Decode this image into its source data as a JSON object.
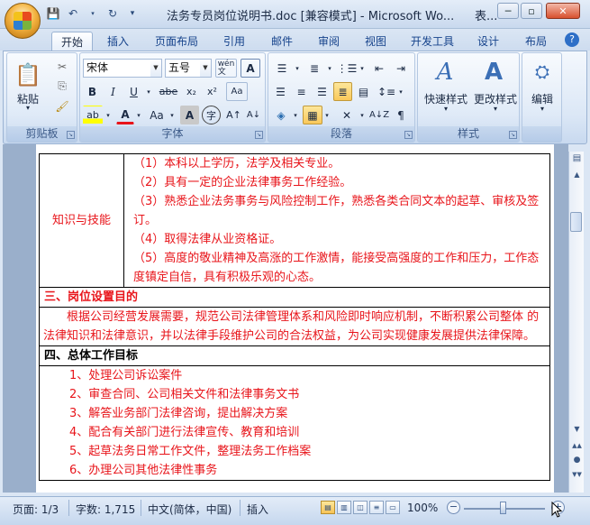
{
  "window": {
    "title": "法务专员岗位说明书.doc [兼容模式] - Microsoft Wo...",
    "extra_title": "表...",
    "controls": {
      "minimize": "─",
      "restore": "▫",
      "close": "✕"
    }
  },
  "qat": {
    "save_icon": "save-icon",
    "undo_icon": "undo-icon",
    "redo_icon": "redo-icon",
    "customize_icon": "chevron-down-icon"
  },
  "tabs": [
    "开始",
    "插入",
    "页面布局",
    "引用",
    "邮件",
    "审阅",
    "视图",
    "开发工具",
    "设计",
    "布局"
  ],
  "active_tab": "开始",
  "ribbon": {
    "clipboard": {
      "label": "剪贴板",
      "paste": "粘贴",
      "paste_arrow": "▾"
    },
    "font": {
      "label": "字体",
      "font_name": "宋体",
      "font_size": "五号",
      "wen": "wén\n文",
      "bold": "B",
      "italic": "I",
      "underline": "U",
      "strike": "abe",
      "sub": "x₂",
      "sup": "x²",
      "clear": "Aa",
      "highlight": "ab",
      "color": "A",
      "case": "Aa",
      "shade": "A",
      "circle": "字",
      "grow": "A↑",
      "shrink": "A↓"
    },
    "paragraph": {
      "label": "段落"
    },
    "styles": {
      "label": "样式",
      "quick": "快速样式",
      "change": "更改样式"
    },
    "editing": {
      "label": "",
      "edit": "编辑"
    }
  },
  "document": {
    "knowledge_label": "知识与技能",
    "requirements": [
      "（1）本科以上学历，法学及相关专业。",
      "（2）具有一定的企业法律事务工作经验。",
      "（3）熟悉企业法务事务与风险控制工作，熟悉各类合同文本的起草、审核及签订。",
      "（4）取得法律从业资格证。",
      "（5）高度的敬业精神及高涨的工作激情，能接受高强度的工作和压力，工作态度镇定自信，具有积极乐观的心态。"
    ],
    "section3_title": "三、岗位设置目的",
    "section3_text": "根据公司经营发展需要，规范公司法律管理体系和风险即时响应机制，不断积累公司整体 的法律知识和法律意识，并以法律手段维护公司的合法权益，为公司实现健康发展提供法律保障。",
    "section4_title": "四、总体工作目标",
    "goals": [
      "1、处理公司诉讼案件",
      "2、审查合同、公司相关文件和法律事务文书",
      "3、解答业务部门法律咨询，提出解决方案",
      "4、配合有关部门进行法律宣传、教育和培训",
      "5、起草法务日常工作文件，整理法务工作档案",
      "6、办理公司其他法律性事务"
    ]
  },
  "statusbar": {
    "page": "页面: 1/3",
    "words": "字数: 1,715",
    "language": "中文(简体，中国)",
    "mode": "插入",
    "zoom": "100%",
    "zoom_level": 1.0
  },
  "colors": {
    "accent": "#15428b",
    "doc_text": "#e8141a",
    "ribbon_bg": "#dbe7f6"
  }
}
